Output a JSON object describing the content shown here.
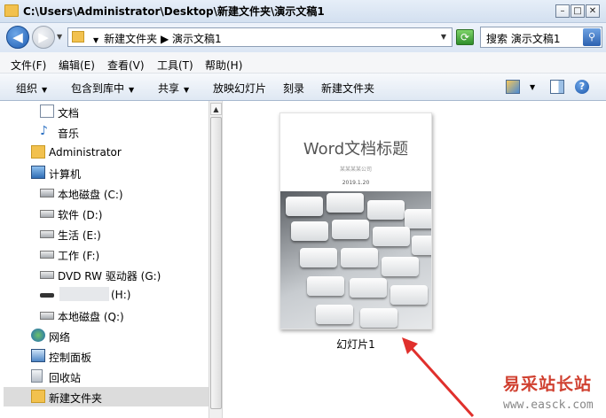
{
  "window": {
    "title": "C:\\Users\\Administrator\\Desktop\\新建文件夹\\演示文稿1",
    "minimize": "–",
    "maximize": "□",
    "close": "✕"
  },
  "address": {
    "path": "新建文件夹  ▶  演示文稿1",
    "back": "◀",
    "forward": "▶",
    "refresh": "⟳",
    "search_text": "搜索 演示文稿1",
    "search_btn": "⚲"
  },
  "menu": [
    "文件(F)",
    "编辑(E)",
    "查看(V)",
    "工具(T)",
    "帮助(H)"
  ],
  "toolbar": {
    "organize": "组织",
    "include_library": "包含到库中",
    "share": "共享",
    "slideshow": "放映幻灯片",
    "burn": "刻录",
    "new_folder": "新建文件夹",
    "help": "?"
  },
  "nav": {
    "items": [
      {
        "label": "文档",
        "icon": "document-icon"
      },
      {
        "label": "音乐",
        "icon": "music-icon"
      },
      {
        "label": "Administrator",
        "icon": "user-folder-icon"
      },
      {
        "label": "计算机",
        "icon": "computer-icon"
      },
      {
        "label": "本地磁盘 (C:)",
        "icon": "system-drive-icon"
      },
      {
        "label": "软件 (D:)",
        "icon": "drive-icon"
      },
      {
        "label": "生活 (E:)",
        "icon": "drive-icon"
      },
      {
        "label": "工作 (F:)",
        "icon": "drive-icon"
      },
      {
        "label": "DVD RW 驱动器 (G:)",
        "icon": "dvd-drive-icon"
      },
      {
        "label": "(H:)",
        "icon": "removable-drive-icon"
      },
      {
        "label": "本地磁盘 (Q:)",
        "icon": "drive-icon"
      },
      {
        "label": "网络",
        "icon": "network-icon"
      },
      {
        "label": "控制面板",
        "icon": "control-panel-icon"
      },
      {
        "label": "回收站",
        "icon": "recycle-bin-icon"
      },
      {
        "label": "新建文件夹",
        "icon": "folder-icon"
      }
    ]
  },
  "file": {
    "name": "幻灯片1",
    "thumb_title": "Word文档标题",
    "thumb_company": "某某某某公司",
    "thumb_date": "2019.1.20"
  },
  "watermark": {
    "line1": "易采站长站",
    "line2": "www.easck.com"
  }
}
